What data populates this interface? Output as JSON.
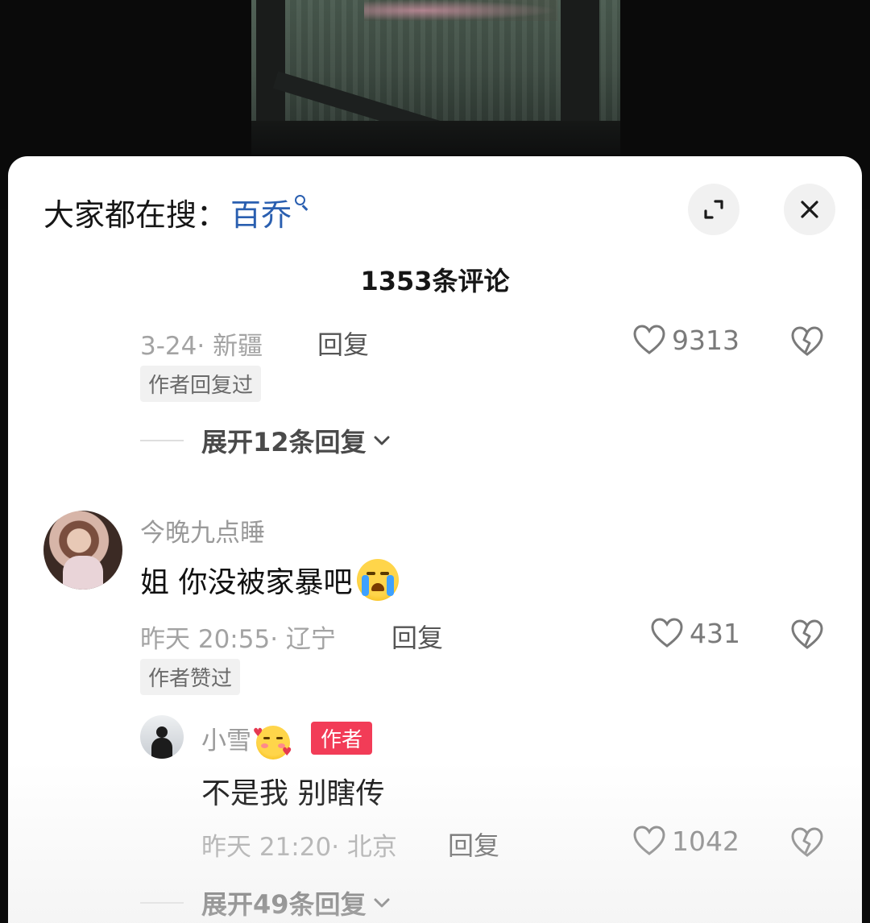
{
  "search_bar": {
    "prefix": "大家都在搜：",
    "term": "百乔"
  },
  "comments_header": {
    "title": "1353条评论"
  },
  "comment_prev": {
    "meta": "3-24· 新疆",
    "reply_label": "回复",
    "likes": "9313",
    "tag": "作者回复过",
    "expand_label": "展开12条回复"
  },
  "comment_main": {
    "username": "今晚九点睡",
    "text": "姐 你没被家暴吧",
    "emoji": "loudly-crying-face",
    "meta": "昨天 20:55· 辽宁",
    "reply_label": "回复",
    "likes": "431",
    "tag": "作者赞过"
  },
  "reply_author": {
    "username": "小雪",
    "emoji": "smiling-face-with-hearts",
    "badge": "作者",
    "text": "不是我 别瞎传",
    "meta": "昨天 21:20· 北京",
    "reply_label": "回复",
    "likes": "1042",
    "expand_label": "展开49条回复"
  },
  "colors": {
    "accent_link": "#2a5fb0",
    "author_badge": "#f23c57"
  }
}
